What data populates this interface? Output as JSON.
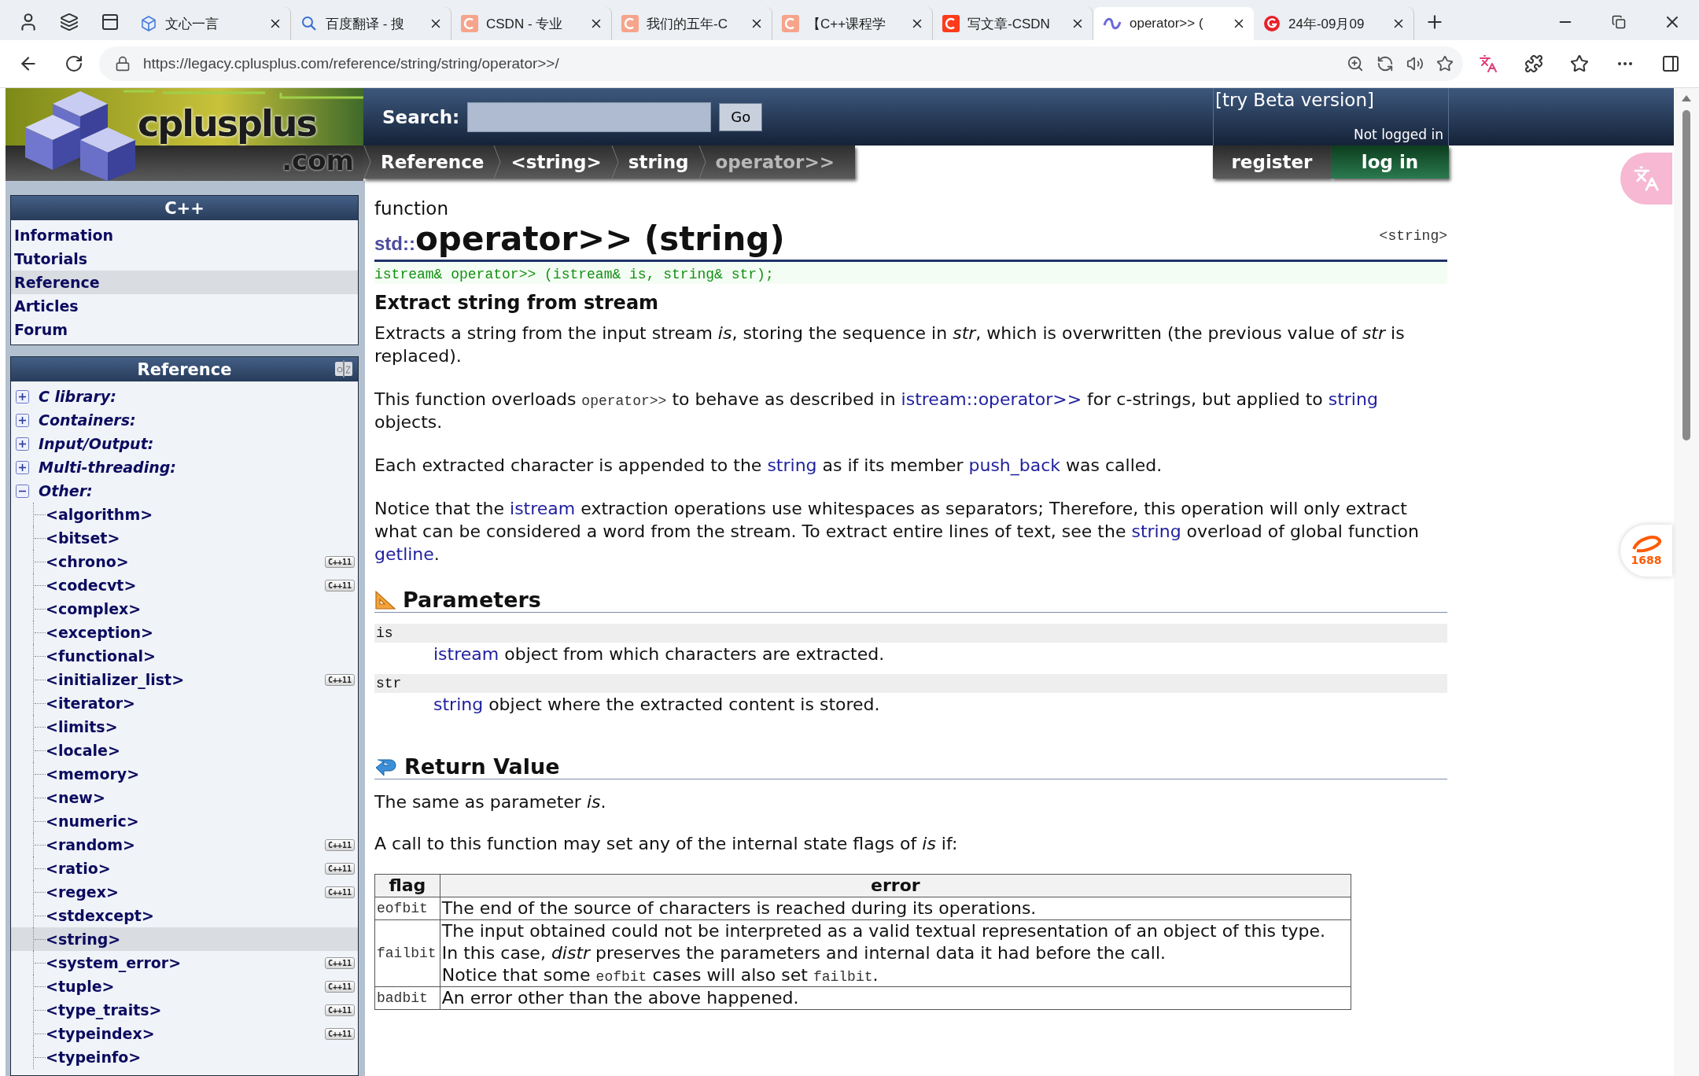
{
  "browser": {
    "tabs": [
      {
        "title": "文心一言",
        "kind": "cube",
        "selected": false
      },
      {
        "title": "百度翻译 - 搜",
        "kind": "search",
        "selected": false
      },
      {
        "title": "CSDN - 专业",
        "kind": "csdn",
        "selected": false
      },
      {
        "title": "我们的五年-C",
        "kind": "csdn",
        "selected": false
      },
      {
        "title": "【C++课程学",
        "kind": "csdn",
        "selected": false
      },
      {
        "title": "写文章-CSDN",
        "kind": "csdnred",
        "selected": false
      },
      {
        "title": "operator>> (",
        "kind": "swirl",
        "selected": true
      },
      {
        "title": "24年-09月09",
        "kind": "gcircle",
        "selected": false
      }
    ],
    "url": "https://legacy.cplusplus.com/reference/string/string/operator>>/"
  },
  "header": {
    "logo": {
      "name": "cplusplus",
      "suffix": ".com"
    },
    "search": {
      "label": "Search:",
      "button": "Go"
    },
    "breadcrumb": [
      {
        "label": "Reference",
        "current": false
      },
      {
        "label": "<string>",
        "current": false
      },
      {
        "label": "string",
        "current": false
      },
      {
        "label": "operator>>",
        "current": true
      }
    ],
    "beta_link": "[try Beta version]",
    "login_status": "Not logged in",
    "register": "register",
    "login": "log in"
  },
  "sidebar": {
    "menu": {
      "title": "C++",
      "items": [
        {
          "label": "Information",
          "selected": false
        },
        {
          "label": "Tutorials",
          "selected": false
        },
        {
          "label": "Reference",
          "selected": true
        },
        {
          "label": "Articles",
          "selected": false
        },
        {
          "label": "Forum",
          "selected": false
        }
      ]
    },
    "reference": {
      "title": "Reference",
      "groups": [
        {
          "label": "C library:",
          "expanded": false
        },
        {
          "label": "Containers:",
          "expanded": false
        },
        {
          "label": "Input/Output:",
          "expanded": false
        },
        {
          "label": "Multi-threading:",
          "expanded": false
        },
        {
          "label": "Other:",
          "expanded": true,
          "children": [
            {
              "label": "<algorithm>",
              "selected": false
            },
            {
              "label": "<bitset>",
              "selected": false
            },
            {
              "label": "<chrono>",
              "selected": false,
              "badge": "C++11"
            },
            {
              "label": "<codecvt>",
              "selected": false,
              "badge": "C++11"
            },
            {
              "label": "<complex>",
              "selected": false
            },
            {
              "label": "<exception>",
              "selected": false
            },
            {
              "label": "<functional>",
              "selected": false
            },
            {
              "label": "<initializer_list>",
              "selected": false,
              "badge": "C++11"
            },
            {
              "label": "<iterator>",
              "selected": false
            },
            {
              "label": "<limits>",
              "selected": false
            },
            {
              "label": "<locale>",
              "selected": false
            },
            {
              "label": "<memory>",
              "selected": false
            },
            {
              "label": "<new>",
              "selected": false
            },
            {
              "label": "<numeric>",
              "selected": false
            },
            {
              "label": "<random>",
              "selected": false,
              "badge": "C++11"
            },
            {
              "label": "<ratio>",
              "selected": false,
              "badge": "C++11"
            },
            {
              "label": "<regex>",
              "selected": false,
              "badge": "C++11"
            },
            {
              "label": "<stdexcept>",
              "selected": false
            },
            {
              "label": "<string>",
              "selected": true
            },
            {
              "label": "<system_error>",
              "selected": false,
              "badge": "C++11"
            },
            {
              "label": "<tuple>",
              "selected": false,
              "badge": "C++11"
            },
            {
              "label": "<type_traits>",
              "selected": false,
              "badge": "C++11"
            },
            {
              "label": "<typeindex>",
              "selected": false,
              "badge": "C++11"
            },
            {
              "label": "<typeinfo>",
              "selected": false
            }
          ]
        }
      ]
    }
  },
  "content": {
    "kind": "function",
    "namespace": "std::",
    "title": "operator>> (string)",
    "header_file": "<string>",
    "prototype": "istream& operator>> (istream& is, string& str);",
    "subtitle": "Extract string from stream",
    "paragraphs": [
      [
        {
          "kind": "text",
          "text": "Extracts a string from the input stream *is*, storing the sequence in *str*, which is overwritten (the previous value of *str* is replaced)."
        }
      ],
      [
        {
          "kind": "text",
          "text": "This function overloads "
        },
        {
          "kind": "code",
          "text": "operator>>"
        },
        {
          "kind": "text",
          "text": " to behave as described in "
        },
        {
          "kind": "link",
          "text": "istream::operator>>"
        },
        {
          "kind": "text",
          "text": " for c-strings, but applied to "
        },
        {
          "kind": "link",
          "text": "string"
        },
        {
          "kind": "text",
          "text": " objects."
        }
      ],
      [
        {
          "kind": "text",
          "text": "Each extracted character is appended to the "
        },
        {
          "kind": "link",
          "text": "string"
        },
        {
          "kind": "text",
          "text": " as if its member "
        },
        {
          "kind": "link",
          "text": "push_back"
        },
        {
          "kind": "text",
          "text": " was called."
        }
      ],
      [
        {
          "kind": "text",
          "text": "Notice that the "
        },
        {
          "kind": "link",
          "text": "istream"
        },
        {
          "kind": "text",
          "text": " extraction operations use whitespaces as separators; Therefore, this operation will only extract what can be considered a word from the stream. To extract entire lines of text, see the "
        },
        {
          "kind": "link",
          "text": "string"
        },
        {
          "kind": "text",
          "text": " overload of global function "
        },
        {
          "kind": "link",
          "text": "getline"
        },
        {
          "kind": "text",
          "text": "."
        }
      ]
    ],
    "parameters": {
      "title": "Parameters",
      "items": [
        {
          "name": "is",
          "desc": [
            {
              "kind": "link",
              "text": "istream"
            },
            {
              "kind": "text",
              "text": " object from which characters are extracted."
            }
          ]
        },
        {
          "name": "str",
          "desc": [
            {
              "kind": "link",
              "text": "string"
            },
            {
              "kind": "text",
              "text": " object where the extracted content is stored."
            }
          ]
        }
      ]
    },
    "return_value": {
      "title": "Return Value",
      "paragraphs": [
        [
          {
            "kind": "text",
            "text": "The same as parameter *is*."
          }
        ],
        [
          {
            "kind": "text",
            "text": "A call to this function may set any of the internal state flags of *is* if:"
          }
        ]
      ],
      "table": {
        "columns": [
          "flag",
          "error"
        ],
        "rows": [
          {
            "flag": "eofbit",
            "lines": [
              [
                {
                  "kind": "text",
                  "text": "The end of the source of characters is reached during its operations."
                }
              ]
            ]
          },
          {
            "flag": "failbit",
            "lines": [
              [
                {
                  "kind": "text",
                  "text": "The input obtained could not be interpreted as a valid textual representation of an object of this type."
                }
              ],
              [
                {
                  "kind": "text",
                  "text": "In this case, *distr* preserves the parameters and internal data it had before the call."
                }
              ],
              [
                {
                  "kind": "text",
                  "text": "Notice that some "
                },
                {
                  "kind": "code",
                  "text": "eofbit"
                },
                {
                  "kind": "text",
                  "text": " cases will also set "
                },
                {
                  "kind": "code",
                  "text": "failbit"
                },
                {
                  "kind": "text",
                  "text": "."
                }
              ]
            ]
          },
          {
            "flag": "badbit",
            "lines": [
              [
                {
                  "kind": "text",
                  "text": "An error other than the above happened."
                }
              ]
            ]
          }
        ]
      }
    }
  },
  "side_widgets": {
    "shop_badge": "1688"
  }
}
